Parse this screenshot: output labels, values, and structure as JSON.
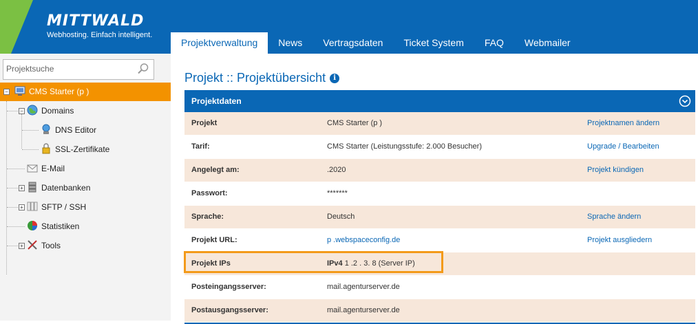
{
  "brand": {
    "name": "MITTWALD",
    "slogan": "Webhosting. Einfach intelligent.",
    "accent": "#0a67b5",
    "green": "#7bc043",
    "orange": "#f39200"
  },
  "nav": [
    {
      "label": "Projektverwaltung",
      "active": true
    },
    {
      "label": "News"
    },
    {
      "label": "Vertragsdaten"
    },
    {
      "label": "Ticket System"
    },
    {
      "label": "FAQ"
    },
    {
      "label": "Webmailer"
    }
  ],
  "sidebar": {
    "search_placeholder": "Projektsuche",
    "tree": {
      "root": {
        "label": "CMS Starter (p           )",
        "icon": "computer-icon"
      },
      "items": [
        {
          "label": "Domains",
          "icon": "globe-icon"
        },
        {
          "label": "DNS Editor",
          "icon": "dns-icon"
        },
        {
          "label": "SSL-Zertifikate",
          "icon": "lock-icon"
        },
        {
          "label": "E-Mail",
          "icon": "mail-icon"
        },
        {
          "label": "Datenbanken",
          "icon": "database-icon"
        },
        {
          "label": "SFTP / SSH",
          "icon": "sftp-icon"
        },
        {
          "label": "Statistiken",
          "icon": "pie-chart-icon"
        },
        {
          "label": "Tools",
          "icon": "tools-icon"
        }
      ]
    }
  },
  "main": {
    "title": "Projekt :: Projektübersicht",
    "panel_title": "Projektdaten",
    "rows": [
      {
        "label": "Projekt",
        "value": "CMS Starter (p           )",
        "action": "Projektnamen ändern"
      },
      {
        "label": "Tarif:",
        "value": "CMS Starter (Leistungsstufe: 2.000 Besucher)",
        "action": "Upgrade / Bearbeiten"
      },
      {
        "label": "Angelegt am:",
        "value": "           .2020",
        "action": "Projekt kündigen"
      },
      {
        "label": "Passwort:",
        "value": "*******",
        "action": ""
      },
      {
        "label": "Sprache:",
        "value": "Deutsch",
        "action": "Sprache ändern"
      },
      {
        "label": "Projekt URL:",
        "value": "p           .webspaceconfig.de",
        "action": "Projekt ausgliedern"
      },
      {
        "label": "Projekt IPs",
        "value_prefix": "IPv4",
        "value": "1    .2    .    3.    8 (Server IP)",
        "action": ""
      },
      {
        "label": "Posteingangsserver:",
        "value": "mail.agenturserver.de",
        "action": ""
      },
      {
        "label": "Postausgangsserver:",
        "value": "mail.agenturserver.de",
        "action": ""
      }
    ]
  }
}
